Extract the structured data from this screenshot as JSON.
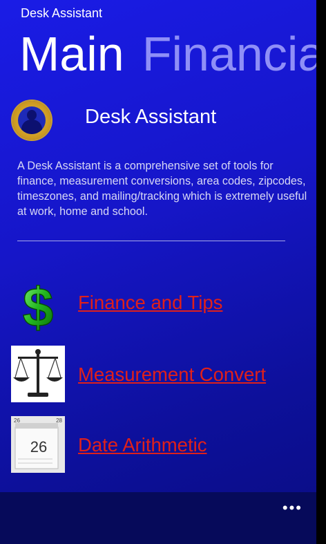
{
  "app": {
    "title": "Desk Assistant"
  },
  "pivot": {
    "active": "Main",
    "inactive": "Financial"
  },
  "header": {
    "title": "Desk Assistant",
    "avatar_icon": "person-avatar-icon"
  },
  "description": "A Desk Assistant is a comprehensive set of tools for finance, measurement conversions, area codes, zipcodes, timeszones, and mailing/tracking which is extremely useful at work, home and school.",
  "menu": {
    "items": [
      {
        "label": "Finance and Tips",
        "icon": "dollar-icon"
      },
      {
        "label": "Measurement Convert",
        "icon": "scales-icon"
      },
      {
        "label": "Date Arithmetic",
        "icon": "calendar-icon"
      }
    ],
    "calendar": {
      "day": "26",
      "corner_left": "26",
      "corner_right": "28"
    }
  },
  "appbar": {
    "more_label": "•••"
  },
  "colors": {
    "accent": "#1a1ce6",
    "link": "#e0201a",
    "appbar": "#060a5a"
  }
}
